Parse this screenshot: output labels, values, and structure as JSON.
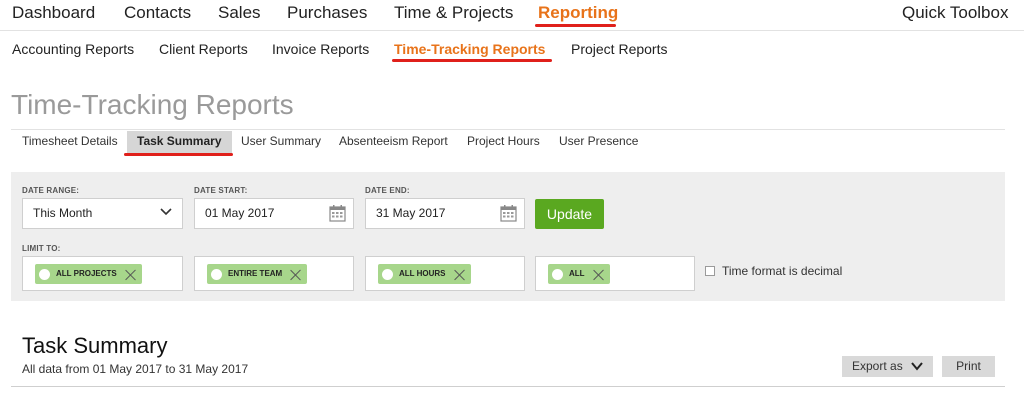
{
  "topnav": {
    "items": [
      "Dashboard",
      "Contacts",
      "Sales",
      "Purchases",
      "Time & Projects",
      "Reporting"
    ],
    "right": "Quick Toolbox",
    "active": "Reporting"
  },
  "subnav": {
    "items": [
      "Accounting Reports",
      "Client Reports",
      "Invoice Reports",
      "Time-Tracking Reports",
      "Project Reports"
    ],
    "active": "Time-Tracking Reports"
  },
  "page_title": "Time-Tracking Reports",
  "tabs": {
    "items": [
      "Timesheet Details",
      "Task Summary",
      "User Summary",
      "Absenteeism Report",
      "Project Hours",
      "User Presence"
    ],
    "active": "Task Summary"
  },
  "filters": {
    "date_range": {
      "label": "DATE RANGE:",
      "value": "This Month"
    },
    "date_start": {
      "label": "DATE START:",
      "value": "01 May 2017"
    },
    "date_end": {
      "label": "DATE END:",
      "value": "31 May 2017"
    },
    "update_label": "Update",
    "limit_label": "LIMIT TO:",
    "limits": [
      "ALL PROJECTS",
      "ENTIRE TEAM",
      "ALL HOURS",
      "ALL"
    ],
    "decimal_label": "Time format is decimal",
    "decimal_checked": false
  },
  "summary": {
    "title": "Task Summary",
    "subtitle": "All data from 01 May 2017 to 31 May 2017",
    "export_label": "Export as",
    "print_label": "Print"
  },
  "colors": {
    "accent_orange": "#e8731a",
    "underline_red": "#e0201b",
    "update_green": "#5aa820",
    "chip_green": "#a7d68b"
  },
  "icons": {
    "dropdown": "chevron-down-icon",
    "calendar": "calendar-icon",
    "chip_remove": "close-icon"
  }
}
